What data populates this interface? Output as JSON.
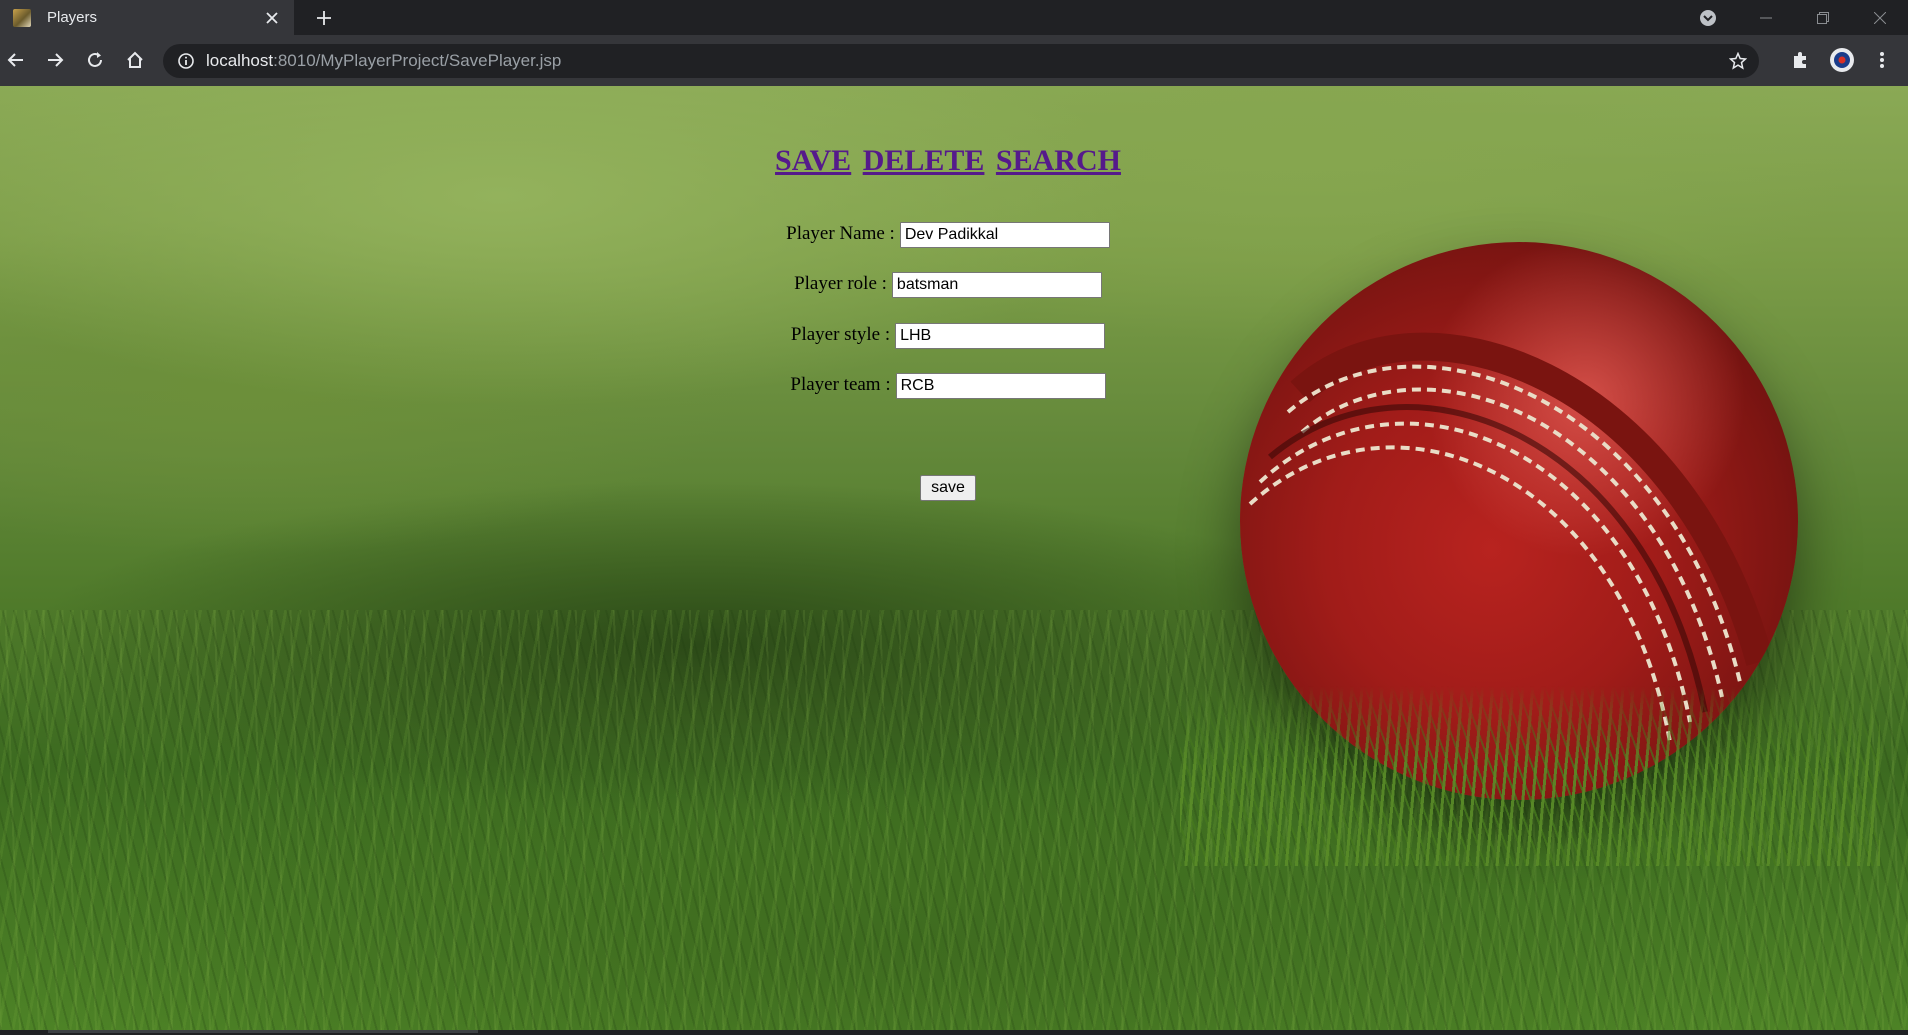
{
  "browser": {
    "tab_title": "Players",
    "url_host": "localhost",
    "url_rest": ":8010/MyPlayerProject/SavePlayer.jsp"
  },
  "nav": {
    "save": "SAVE",
    "delete": "DELETE",
    "search": "SEARCH"
  },
  "form": {
    "name_label": "Player Name :",
    "name_value": "Dev Padikkal",
    "role_label": "Player role :",
    "role_value": "batsman",
    "style_label": "Player style :",
    "style_value": "LHB",
    "team_label": "Player team :",
    "team_value": "RCB",
    "submit_label": "save"
  },
  "colors": {
    "link": "#551a8b",
    "chrome_dark": "#202124",
    "chrome_toolbar": "#35363a"
  },
  "icons": [
    "favicon-icon",
    "close-icon",
    "plus-icon",
    "back-icon",
    "forward-icon",
    "reload-icon",
    "home-icon",
    "info-icon",
    "star-icon",
    "extensions-icon",
    "profile-icon",
    "menu-icon",
    "tab-search-icon",
    "minimize-icon",
    "restore-icon",
    "window-close-icon"
  ]
}
